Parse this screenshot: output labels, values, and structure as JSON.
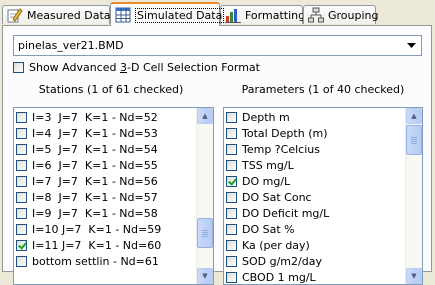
{
  "tabs": [
    {
      "label": "Measured Data",
      "icon": "edit-pencil-icon",
      "active": false
    },
    {
      "label": "Simulated Data",
      "icon": "grid-table-icon",
      "active": true
    },
    {
      "label": "Formatting",
      "icon": "bar-chart-icon",
      "active": false
    },
    {
      "label": "Grouping",
      "icon": "hierarchy-icon",
      "active": false
    }
  ],
  "file_select": {
    "value": "pinelas_ver21.BMD"
  },
  "advanced_option": {
    "pre": "Show Advanced ",
    "accel": "3",
    "post": "-D Cell Selection Format",
    "checked": false
  },
  "stations": {
    "header": "Stations (1 of 61 checked)",
    "items": [
      {
        "label": "I=3  J=7  K=1 - Nd=52",
        "checked": false
      },
      {
        "label": "I=4  J=7  K=1 - Nd=53",
        "checked": false
      },
      {
        "label": "I=5  J=7  K=1 - Nd=54",
        "checked": false
      },
      {
        "label": "I=6  J=7  K=1 - Nd=55",
        "checked": false
      },
      {
        "label": "I=7  J=7  K=1 - Nd=56",
        "checked": false
      },
      {
        "label": "I=8  J=7  K=1 - Nd=57",
        "checked": false
      },
      {
        "label": "I=9  J=7  K=1 - Nd=58",
        "checked": false
      },
      {
        "label": "I=10 J=7  K=1 - Nd=59",
        "checked": false
      },
      {
        "label": "I=11 J=7  K=1 - Nd=60",
        "checked": true
      },
      {
        "label": "bottom settlin - Nd=61",
        "checked": false
      }
    ]
  },
  "parameters": {
    "header": "Parameters (1 of 40 checked)",
    "items": [
      {
        "label": "Depth m",
        "checked": false
      },
      {
        "label": "Total Depth (m)",
        "checked": false
      },
      {
        "label": "Temp ?Celcius",
        "checked": false
      },
      {
        "label": "TSS mg/L",
        "checked": false
      },
      {
        "label": "DO mg/L",
        "checked": true
      },
      {
        "label": "DO Sat Conc",
        "checked": false
      },
      {
        "label": "DO Deficit mg/L",
        "checked": false
      },
      {
        "label": "DO Sat %",
        "checked": false
      },
      {
        "label": "Ka (per day)",
        "checked": false
      },
      {
        "label": "SOD g/m2/day",
        "checked": false
      },
      {
        "label": "CBOD 1 mg/L",
        "checked": false
      }
    ]
  },
  "colors": {
    "active_tab_accent": "#e68b2c",
    "check_mark": "#21a121",
    "panel_bg": "#fcfcfe",
    "window_bg": "#ece9d8"
  }
}
